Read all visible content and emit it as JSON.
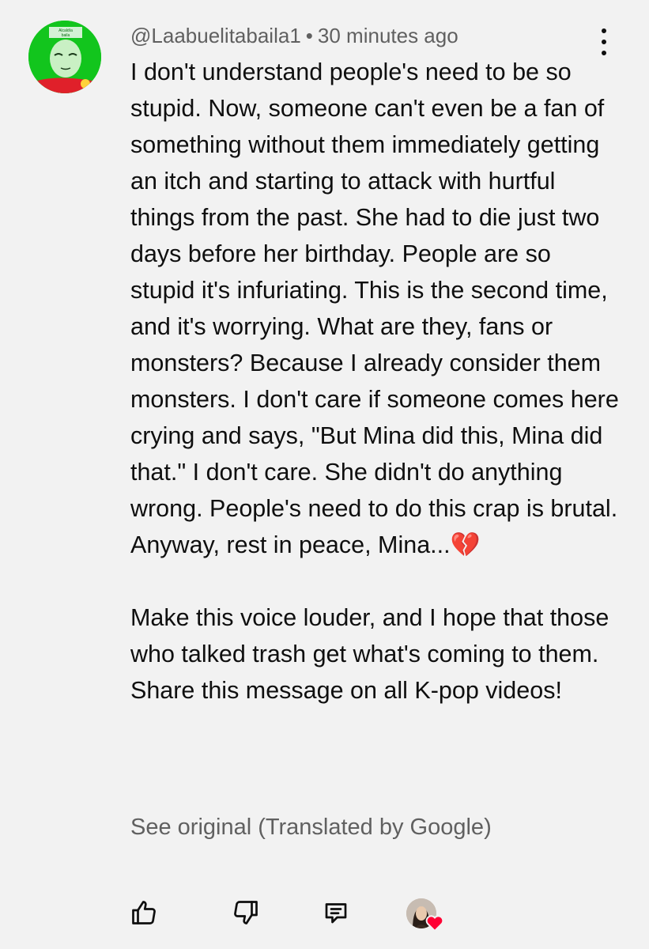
{
  "comment": {
    "handle": "@Laabuelitabaila1",
    "separator": "•",
    "timestamp": "30 minutes ago",
    "avatar_text": "Alcaldía baila",
    "avatar_colors": {
      "bg": "#12c51d",
      "accent": "#e0202a"
    },
    "paragraphs": [
      "I don't understand people's need to be so stupid. Now, someone can't even be a fan of something without them immediately getting an itch and starting to attack with hurtful things from the past. She had to die just two days before her birthday. People are so stupid it's infuriating. This is the second time, and it's worrying. What are they, fans or monsters? Because I already consider them monsters. I don't care if someone comes here crying and says, \"But Mina did this, Mina did that.\" I don't care. She didn't do anything wrong. People's need to do this crap is brutal. Anyway, rest in peace, Mina...💔",
      "Make this voice louder, and I hope that those who talked trash get what's coming to them. Share this message on all K-pop videos!"
    ],
    "translate_link": "See original (Translated by Google)"
  },
  "actions": {
    "like_icon": "thumbs-up-icon",
    "dislike_icon": "thumbs-down-icon",
    "reply_icon": "reply-icon",
    "creator_heart_icon": "creator-heart-icon",
    "heart_color": "#ff0033"
  },
  "menu_icon": "more-vert-icon"
}
